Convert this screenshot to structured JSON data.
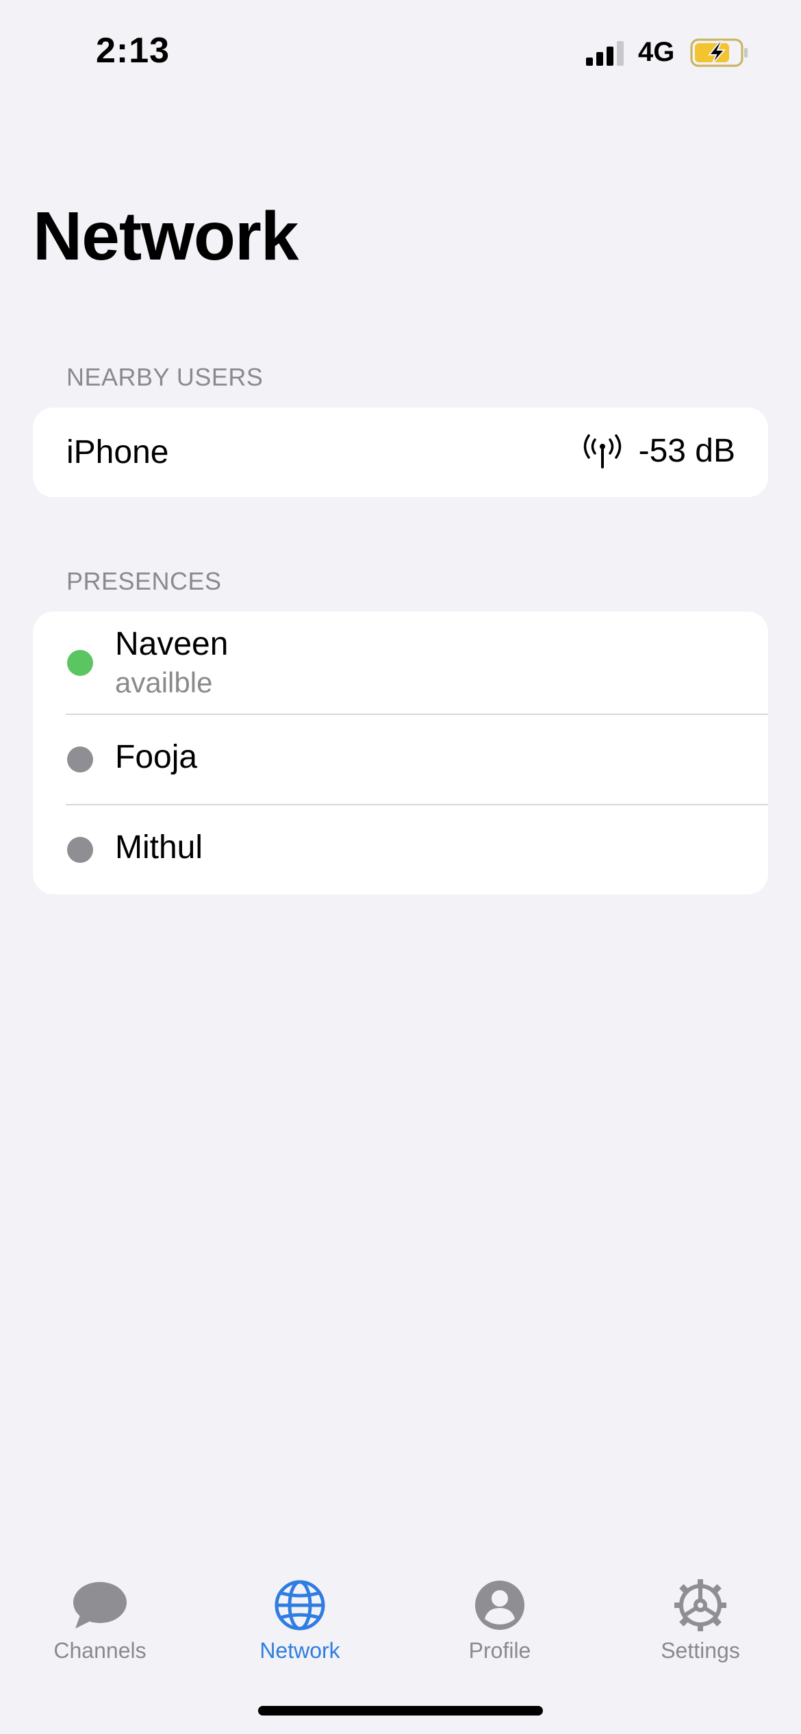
{
  "status_bar": {
    "time": "2:13",
    "network_type": "4G",
    "signal_icon": "cellular-signal-icon",
    "battery_icon": "battery-charging-icon"
  },
  "page": {
    "title": "Network"
  },
  "nearby_users": {
    "header": "NEARBY USERS",
    "items": [
      {
        "name": "iPhone",
        "signal": "-53 dB",
        "icon": "antenna-icon"
      }
    ]
  },
  "presences": {
    "header": "PRESENCES",
    "items": [
      {
        "name": "Naveen",
        "status": "availble",
        "status_color": "#5ac561"
      },
      {
        "name": "Fooja",
        "status_color": "#8e8e93"
      },
      {
        "name": "Mithul",
        "status_color": "#8e8e93"
      }
    ]
  },
  "tab_bar": {
    "accent_color": "#2f7de1",
    "inactive_color": "#8e8e93",
    "tabs": [
      {
        "label": "Channels",
        "icon": "chat-bubble-icon",
        "active": false
      },
      {
        "label": "Network",
        "icon": "globe-icon",
        "active": true
      },
      {
        "label": "Profile",
        "icon": "person-circle-icon",
        "active": false
      },
      {
        "label": "Settings",
        "icon": "gear-icon",
        "active": false
      }
    ]
  }
}
